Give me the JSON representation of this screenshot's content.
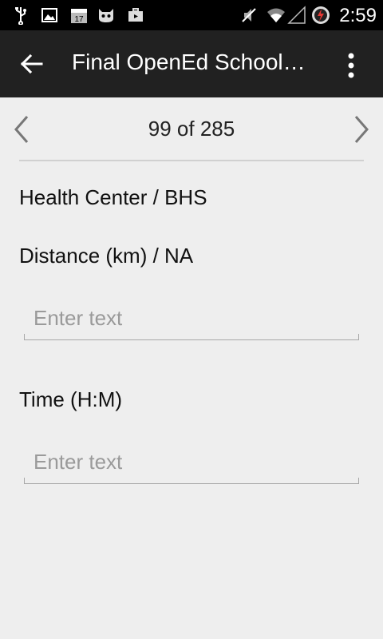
{
  "status_bar": {
    "time": "2:59",
    "icons": [
      "usb-icon",
      "image-icon",
      "calendar-icon",
      "cat-icon",
      "briefcase-icon",
      "mute-icon",
      "wifi-icon",
      "signal-icon",
      "battery-charging-icon"
    ],
    "calendar_day": "17"
  },
  "action_bar": {
    "title": "Final OpenEd School…",
    "back_icon": "arrow-back-icon",
    "overflow_icon": "more-vert-icon"
  },
  "navigation": {
    "counter": "99 of 285",
    "prev_icon": "chevron-left-icon",
    "next_icon": "chevron-right-icon"
  },
  "form": {
    "heading": "Health Center / BHS",
    "fields": [
      {
        "label": "Distance (km) / NA",
        "value": "",
        "placeholder": "Enter text"
      },
      {
        "label": "Time (H:M)",
        "value": "",
        "placeholder": "Enter text"
      }
    ]
  },
  "colors": {
    "status_bar": "#000000",
    "action_bar": "#212121",
    "background": "#eeeeee"
  }
}
